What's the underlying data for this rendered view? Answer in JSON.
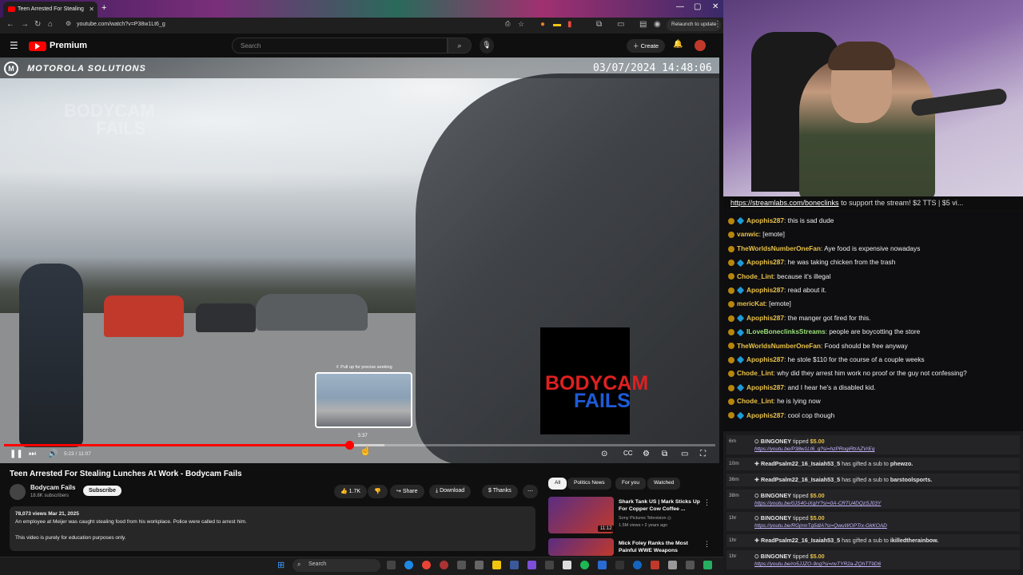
{
  "browser": {
    "tab_title": "Teen Arrested For Stealing",
    "url": "youtube.com/watch?v=P38w1Lt6_g",
    "relaunch_label": "Relaunch to update"
  },
  "yt_header": {
    "logo_text": "Premium",
    "search_placeholder": "Search",
    "create_label": "Create"
  },
  "video": {
    "brand_text": "MOTOROLA SOLUTIONS",
    "timestamp": "03/07/2024 14:48:06",
    "watermark_line1": "BODYCAM",
    "watermark_line2": "FAILS",
    "logo_line1": "BODYCAM",
    "logo_line2": "FAILS",
    "seek_hint": "⇳ Pull up for precise seeking",
    "preview_time": "5:37",
    "current_time": "5:23 / 11:07",
    "progress_fraction": 0.485,
    "buffered_fraction": 0.535
  },
  "details": {
    "title": "Teen Arrested For Stealing Lunches At Work - Bodycam Fails",
    "channel_name": "Bodycam Fails",
    "channel_subs": "18.8K subscribers",
    "subscribe_label": "Subscribe",
    "likes": "1.7K",
    "share_label": "Share",
    "download_label": "Download",
    "thanks_label": "Thanks",
    "desc_stats": "78,073 views  Mar 21, 2025",
    "desc_line1": "An employee at Meijer was caught stealing food from his workplace. Police were called to arrest him.",
    "desc_line2": "This video is purely for education purposes only."
  },
  "chips": [
    "All",
    "Politics News",
    "For you",
    "Watched"
  ],
  "recommendations": [
    {
      "title": "Shark Tank US | Mark Sticks Up For Copper Cow Coffee ...",
      "channel": "Sony Pictures Television ◎",
      "meta": "1.5M views • 2 years ago",
      "duration": "11:12"
    },
    {
      "title": "Mick Foley Ranks the Most Painful WWE Weapons",
      "channel": "",
      "meta": "",
      "duration": ""
    }
  ],
  "taskbar": {
    "search_label": "Search"
  },
  "stream": {
    "ticker_link": "https://streamlabs.com/boneclinks",
    "ticker_text": " to support the stream! $2 TTS | $5 vi...",
    "chat": [
      {
        "user": "Apophis287",
        "text": "this is sad dude",
        "badge": "diamond"
      },
      {
        "user": "vanwic",
        "text": "[emote]",
        "badge": "none"
      },
      {
        "user": "TheWorldsNumberOneFan",
        "text": "Aye food is expensive nowadays",
        "badge": "none"
      },
      {
        "user": "Apophis287",
        "text": "he was taking chicken from the trash",
        "badge": "diamond"
      },
      {
        "user": "Chode_Lint",
        "text": "because it's illegal",
        "badge": "none"
      },
      {
        "user": "Apophis287",
        "text": "read about it.",
        "badge": "diamond"
      },
      {
        "user": "mericKat",
        "text": "[emote]",
        "badge": "none"
      },
      {
        "user": "Apophis287",
        "text": "the manger got fired for this.",
        "badge": "diamond"
      },
      {
        "user": "ILoveBoneclinksStreams",
        "text": "people are boycotting the store",
        "badge": "sword"
      },
      {
        "user": "TheWorldsNumberOneFan",
        "text": "Food should be free anyway",
        "badge": "none"
      },
      {
        "user": "Apophis287",
        "text": "he stole $110 for the course of a couple weeks",
        "badge": "diamond"
      },
      {
        "user": "Chode_Lint",
        "text": "why did they arrest him work no proof or the guy not confessing?",
        "badge": "none"
      },
      {
        "user": "Apophis287",
        "text": "and I hear he's a disabled kid.",
        "badge": "diamond"
      },
      {
        "user": "Chode_Lint",
        "text": "he is lying now",
        "badge": "none"
      },
      {
        "user": "Apophis287",
        "text": "cool cop though",
        "badge": "diamond"
      }
    ],
    "events": [
      {
        "time": "6m",
        "user": "BINGONEY",
        "action": "tipped",
        "amount": "$5.00",
        "link": "https://youtu.be/P38w1Lt6_g?si=hzPRogiRtrAZVrEq"
      },
      {
        "time": "10m",
        "user": "ReadPsalm22_16_Isaiah53_5",
        "action": "has gifted a sub to",
        "target": "phewzo."
      },
      {
        "time": "36m",
        "user": "ReadPsalm22_16_Isaiah53_5",
        "action": "has gifted a sub to",
        "target": "barstoolsports."
      },
      {
        "time": "38m",
        "user": "BINGONEY",
        "action": "tipped",
        "amount": "$5.00",
        "link": "https://youtu.be/0JS40-iXgIY?si=0A-CRTU4DQzSJ03Y"
      },
      {
        "time": "1hr",
        "user": "BINGONEY",
        "action": "tipped",
        "amount": "$5.00",
        "link": "https://youtu.be/RGjmnTg5dlA?si=QwuWOPTrx-GkKOAD"
      },
      {
        "time": "1hr",
        "user": "ReadPsalm22_16_Isaiah53_5",
        "action": "has gifted a sub to",
        "target": "ikilledtherainbow."
      },
      {
        "time": "1hr",
        "user": "BINGONEY",
        "action": "tipped",
        "amount": "$5.00",
        "link": "https://youtu.be/ro5JJZO-9ng?si=nvTYR2a-ZQhTT9D6"
      }
    ]
  },
  "colors": {
    "accent": "#ff0000",
    "chat_user": "#e8c14a",
    "link": "#c8b7ff"
  }
}
